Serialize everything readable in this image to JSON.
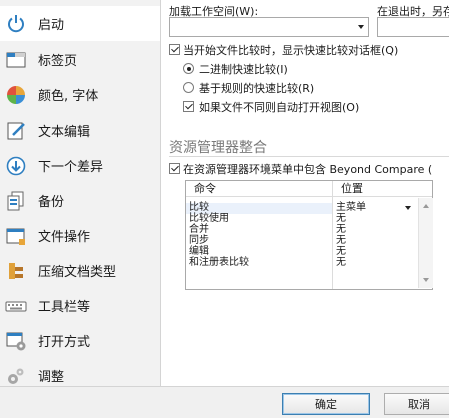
{
  "sidebar": {
    "items": [
      {
        "label": "启动",
        "icon": "power-icon",
        "selected": true
      },
      {
        "label": "标签页",
        "icon": "tab-window-icon"
      },
      {
        "label": "颜色, 字体",
        "icon": "color-palette-icon"
      },
      {
        "label": "文本编辑",
        "icon": "edit-pencil-icon"
      },
      {
        "label": "下一个差异",
        "icon": "arrow-down-circle-icon"
      },
      {
        "label": "备份",
        "icon": "backup-files-icon"
      },
      {
        "label": "文件操作",
        "icon": "file-window-icon"
      },
      {
        "label": "压缩文档类型",
        "icon": "archive-clamp-icon"
      },
      {
        "label": "工具栏等",
        "icon": "keyboard-icon"
      },
      {
        "label": "打开方式",
        "icon": "open-with-icon"
      },
      {
        "label": "调整",
        "icon": "gears-icon"
      }
    ]
  },
  "startup": {
    "load_workspace_label": "加载工作空间(W):",
    "on_exit_label": "在退出时，另存",
    "show_quick_compare_label": "当开始文件比较时，显示快速比较对话框(Q)",
    "binary_quick_compare_label": "二进制快速比较(I)",
    "rules_quick_compare_label": "基于规则的快速比较(R)",
    "auto_open_view_label": "如果文件不同则自动打开视图(O)"
  },
  "explorer": {
    "section_title": "资源管理器整合",
    "include_context_menu_label": "在资源管理器环境菜单中包含 Beyond Compare (",
    "columns": [
      "命令",
      "位置"
    ],
    "rows": [
      {
        "command": "比较",
        "position": "主菜单"
      },
      {
        "command": "比较使用",
        "position": "无"
      },
      {
        "command": "合并",
        "position": "无"
      },
      {
        "command": "同步",
        "position": "无"
      },
      {
        "command": "编辑",
        "position": "无"
      },
      {
        "command": "和注册表比较",
        "position": "无"
      }
    ]
  },
  "footer": {
    "ok_label": "确定",
    "cancel_label": "取消"
  },
  "colors": {
    "accent_icon_blue": "#2f7fc1",
    "sidebar_bg": "#f2f2f2",
    "section_gray": "#7a7a7a"
  }
}
